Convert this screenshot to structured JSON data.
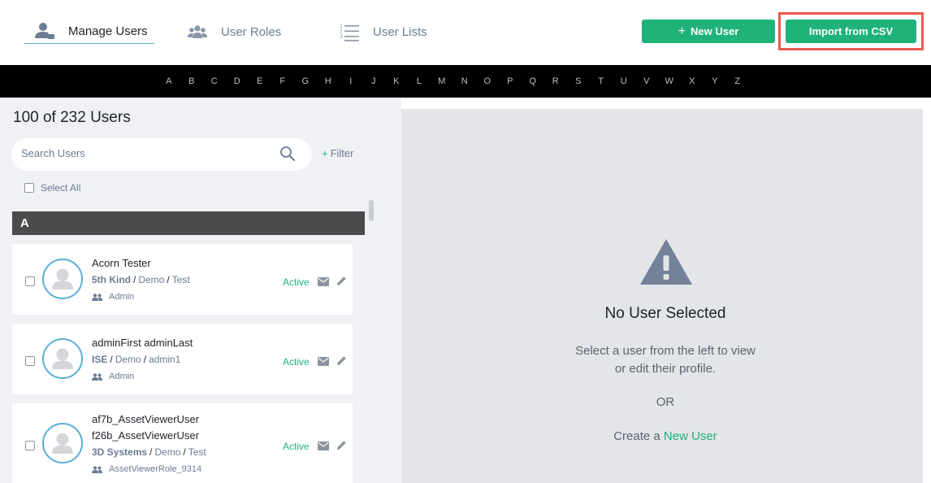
{
  "nav": {
    "tabs": [
      {
        "label": "Manage Users",
        "icon": "user-admin-icon",
        "active": true
      },
      {
        "label": "User Roles",
        "icon": "user-group-icon",
        "active": false
      },
      {
        "label": "User Lists",
        "icon": "numbered-list-icon",
        "active": false
      }
    ],
    "new_user_label": "New User",
    "import_label": "Import from CSV"
  },
  "alphabet": [
    "A",
    "B",
    "C",
    "D",
    "E",
    "F",
    "G",
    "H",
    "I",
    "J",
    "K",
    "L",
    "M",
    "N",
    "O",
    "P",
    "Q",
    "R",
    "S",
    "T",
    "U",
    "V",
    "W",
    "X",
    "Y",
    "Z"
  ],
  "sidebar": {
    "count_text": "100 of 232 Users",
    "search_placeholder": "Search Users",
    "filter_label": "Filter",
    "select_all_label": "Select All",
    "group_letter": "A",
    "users": [
      {
        "name_lines": [
          "Acorn Tester"
        ],
        "org": "5th Kind",
        "path": [
          "Demo",
          "Test"
        ],
        "role": "Admin",
        "status": "Active"
      },
      {
        "name_lines": [
          "adminFirst adminLast"
        ],
        "org": "ISE",
        "path": [
          "Demo",
          "admin1"
        ],
        "role": "Admin",
        "status": "Active"
      },
      {
        "name_lines": [
          "af7b_AssetViewerUser",
          "f26b_AssetViewerUser"
        ],
        "org": "3D Systems",
        "path": [
          "Demo",
          "Test"
        ],
        "role": "AssetViewerRole_9314",
        "status": "Active"
      }
    ]
  },
  "detail": {
    "title": "No User Selected",
    "hint_line1": "Select a user from the left to view",
    "hint_line2": "or edit their profile.",
    "or_text": "OR",
    "create_prefix": "Create a",
    "create_link": "New User"
  },
  "colors": {
    "accent_green": "#1fb37a",
    "highlight_red": "#ea5a4f",
    "avatar_ring": "#5aaed9",
    "alpha_bar": "#000000"
  }
}
